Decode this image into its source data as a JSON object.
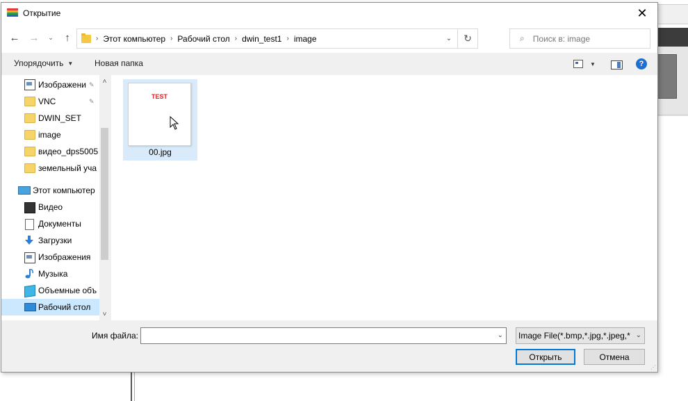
{
  "dialog": {
    "title": "Открытие",
    "close_glyph": "✕"
  },
  "nav": {
    "back_glyph": "←",
    "forward_glyph": "→",
    "recent_glyph": "⌄",
    "up_glyph": "↑",
    "breadcrumbs": [
      "Этот компьютер",
      "Рабочий стол",
      "dwin_test1",
      "image"
    ],
    "separator": "›",
    "dropdown_glyph": "⌄",
    "refresh_glyph": "↻",
    "search_placeholder": "Поиск в: image",
    "search_glyph": "⌕"
  },
  "toolbar": {
    "organize_label": "Упорядочить",
    "organize_caret": "▼",
    "new_folder_label": "Новая папка",
    "view_caret": "▼",
    "help_glyph": "?"
  },
  "sidebar": {
    "items": [
      {
        "label": "Изображени",
        "icon": "pictures-icon",
        "pinned": true
      },
      {
        "label": "VNC",
        "icon": "folder-icon",
        "pinned": true
      },
      {
        "label": "DWIN_SET",
        "icon": "folder-icon",
        "pinned": false
      },
      {
        "label": "image",
        "icon": "folder-icon",
        "pinned": false
      },
      {
        "label": "видео_dps5005",
        "icon": "folder-icon",
        "pinned": false
      },
      {
        "label": "земельный уча",
        "icon": "folder-icon",
        "pinned": false
      },
      {
        "label": "Этот компьютер",
        "icon": "computer-icon",
        "pinned": false
      },
      {
        "label": "Видео",
        "icon": "video-icon",
        "pinned": false
      },
      {
        "label": "Документы",
        "icon": "documents-icon",
        "pinned": false
      },
      {
        "label": "Загрузки",
        "icon": "downloads-icon",
        "pinned": false
      },
      {
        "label": "Изображения",
        "icon": "pictures-icon",
        "pinned": false
      },
      {
        "label": "Музыка",
        "icon": "music-icon",
        "pinned": false
      },
      {
        "label": "Объемные объ",
        "icon": "3d-objects-icon",
        "pinned": false
      },
      {
        "label": "Рабочий стол",
        "icon": "desktop-icon",
        "pinned": false,
        "selected": true
      }
    ],
    "pin_glyph": "📌",
    "scroll_up_glyph": "˄",
    "scroll_down_glyph": "˅"
  },
  "files": [
    {
      "name": "00.jpg",
      "thumb_text": "TEST",
      "selected": true
    }
  ],
  "bottom": {
    "filename_label": "Имя файла:",
    "filename_value": "",
    "filename_caret": "⌄",
    "filter_value": "Image File(*.bmp,*.jpg,*.jpeg,*",
    "filter_caret": "⌄",
    "open_label": "Открыть",
    "cancel_label": "Отмена"
  },
  "colors": {
    "selection": "#cce8ff",
    "accent": "#0078d7",
    "help": "#1e6fd1",
    "thumb_text": "#d9242a"
  }
}
